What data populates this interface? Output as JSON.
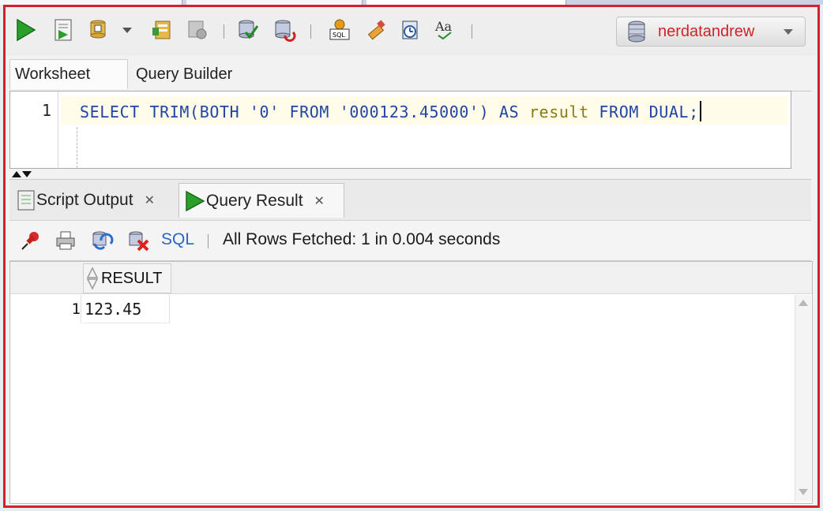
{
  "accent_color": "#d4202a",
  "toolbar": {
    "buttons": [
      {
        "name": "run-statement-icon"
      },
      {
        "name": "run-script-icon"
      },
      {
        "name": "commit-icon"
      },
      {
        "name": "rollback-icon"
      },
      {
        "name": "cancel-icon"
      },
      {
        "name": "sql-tuning-icon"
      },
      {
        "name": "explain-plan-icon"
      },
      {
        "name": "autotrace-icon"
      },
      {
        "name": "sql-history-icon"
      },
      {
        "name": "clear-icon"
      },
      {
        "name": "sql-tuning-advisor-icon"
      },
      {
        "name": "format-case-icon"
      }
    ],
    "connection": {
      "label": "nerdatandrew"
    }
  },
  "sheet_tabs": [
    {
      "label": "Worksheet",
      "active": true
    },
    {
      "label": "Query Builder",
      "active": false
    }
  ],
  "editor": {
    "line_number": "1",
    "code_tokens": {
      "t1": "SELECT TRIM(BOTH ",
      "t2": "'0'",
      "t3": " FROM ",
      "t4": "'000123.45000'",
      "t5": ") AS ",
      "t6": "result",
      "t7": " FROM DUAL;"
    }
  },
  "bottom_tabs": [
    {
      "label": "Script Output",
      "active": false
    },
    {
      "label": "Query Result",
      "active": true
    }
  ],
  "result_toolbar": {
    "sql_label": "SQL",
    "status": "All Rows Fetched: 1 in 0.004 seconds"
  },
  "grid": {
    "columns": [
      "RESULT"
    ],
    "rows": [
      {
        "num": "1",
        "values": [
          "123.45"
        ]
      }
    ]
  }
}
